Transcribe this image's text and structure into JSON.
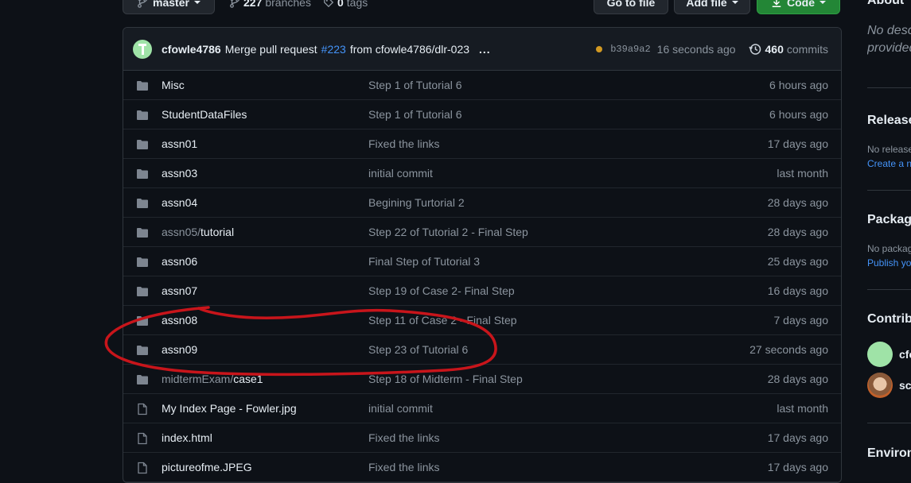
{
  "topbar": {
    "branch_label": "master",
    "branches_count": "227",
    "branches_label": "branches",
    "tags_count": "0",
    "tags_label": "tags",
    "go_to_file_label": "Go to file",
    "add_file_label": "Add file",
    "code_label": "Code"
  },
  "commit": {
    "author": "cfowle4786",
    "message": "Merge pull request",
    "pr_link": "#223",
    "message_rest": "from cfowle4786/dlr-023",
    "ellipsis": "...",
    "sha": "b39a9a2",
    "time": "16 seconds ago",
    "commits_count": "460",
    "commits_label": "commits",
    "status_color": "#d29922"
  },
  "files": [
    {
      "type": "folder",
      "name": "Misc",
      "message": "Step 1 of Tutorial 6",
      "age": "6 hours ago"
    },
    {
      "type": "folder",
      "name": "StudentDataFiles",
      "message": "Step 1 of Tutorial 6",
      "age": "6 hours ago"
    },
    {
      "type": "folder",
      "name": "assn01",
      "message": "Fixed the links",
      "age": "17 days ago"
    },
    {
      "type": "folder",
      "name": "assn03",
      "message": "initial commit",
      "age": "last month"
    },
    {
      "type": "folder",
      "name": "assn04",
      "message": "Begining Turtorial 2",
      "age": "28 days ago"
    },
    {
      "type": "folder",
      "name_prefix": "assn05/",
      "name": "tutorial",
      "message": "Step 22 of Tutorial 2 - Final Step",
      "age": "28 days ago"
    },
    {
      "type": "folder",
      "name": "assn06",
      "message": "Final Step of Tutorial 3",
      "age": "25 days ago"
    },
    {
      "type": "folder",
      "name": "assn07",
      "message": "Step 19 of Case 2- Final Step",
      "age": "16 days ago"
    },
    {
      "type": "folder",
      "name": "assn08",
      "message": "Step 11 of Case 2 - Final Step",
      "age": "7 days ago"
    },
    {
      "type": "folder",
      "name": "assn09",
      "message": "Step 23 of Tutorial 6",
      "age": "27 seconds ago"
    },
    {
      "type": "folder",
      "name_prefix": "midtermExam/",
      "name": "case1",
      "message": "Step 18 of Midterm - Final Step",
      "age": "28 days ago"
    },
    {
      "type": "file",
      "name": "My Index Page - Fowler.jpg",
      "message": "initial commit",
      "age": "last month"
    },
    {
      "type": "file",
      "name": "index.html",
      "message": "Fixed the links",
      "age": "17 days ago"
    },
    {
      "type": "file",
      "name": "pictureofme.JPEG",
      "message": "Fixed the links",
      "age": "17 days ago"
    }
  ],
  "sidebar": {
    "about_heading": "About",
    "about_text_1": "No desc",
    "about_text_2": "provided",
    "releases_heading": "Release",
    "releases_text": "No release",
    "releases_link": "Create a ne",
    "packages_heading": "Package",
    "packages_text": "No packag",
    "packages_link": "Publish yo",
    "contributors_heading": "Contrib",
    "contributor_1": "cfo",
    "contributor_2": "sco",
    "environments_heading": "Environ"
  },
  "annotation": {
    "color": "#c8151b",
    "shape": "hand-drawn ellipse around assn09 row"
  }
}
